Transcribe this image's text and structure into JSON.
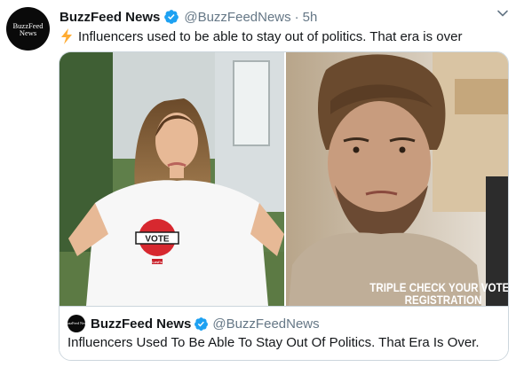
{
  "tweet": {
    "author_name": "BuzzFeed News",
    "author_handle": "@BuzzFeedNews",
    "separator": "·",
    "time_ago": "5h",
    "avatar_text": "BuzzFeed News",
    "text": "Influencers used to be able to stay out of politics. That era is over"
  },
  "media": {
    "left_shirt_text": "VOTE",
    "left_shirt_small": "Levi's",
    "caption_line1": "TRIPLE CHECK YOUR VOTER",
    "caption_line2": "REGISTRATION"
  },
  "quote": {
    "avatar_text": "BuzzFeed News",
    "author_name": "BuzzFeed News",
    "author_handle": "@BuzzFeedNews",
    "title": "Influencers Used To Be Able To Stay Out Of Politics. That Era Is Over."
  },
  "colors": {
    "verified_blue": "#1da1f2",
    "secondary_text": "#657786",
    "bolt_yellow": "#ffac33"
  }
}
